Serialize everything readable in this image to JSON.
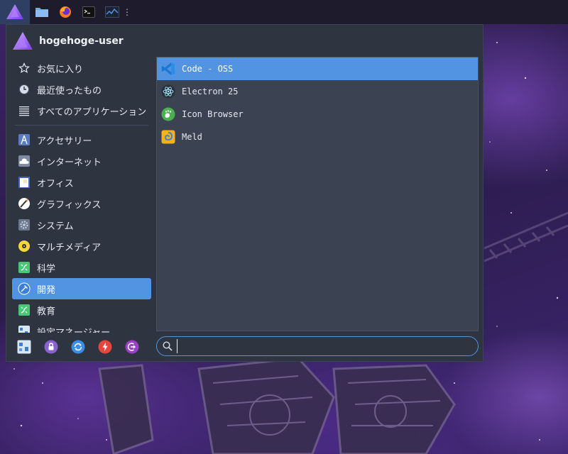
{
  "panel": {
    "apps": [
      {
        "name": "file-manager-icon"
      },
      {
        "name": "firefox-icon"
      },
      {
        "name": "terminal-icon"
      },
      {
        "name": "system-monitor-icon"
      }
    ],
    "separator_glyph": "⋮"
  },
  "menu": {
    "user_name": "hogehoge-user",
    "categories_top": [
      {
        "label": "お気に入り",
        "icon": "star-icon"
      },
      {
        "label": "最近使ったもの",
        "icon": "clock-icon"
      },
      {
        "label": "すべてのアプリケーション",
        "icon": "list-icon"
      }
    ],
    "categories": [
      {
        "label": "アクセサリー",
        "icon": "accessories-icon"
      },
      {
        "label": "インターネット",
        "icon": "cloud-icon"
      },
      {
        "label": "オフィス",
        "icon": "office-icon"
      },
      {
        "label": "グラフィックス",
        "icon": "graphics-icon"
      },
      {
        "label": "システム",
        "icon": "gear-icon"
      },
      {
        "label": "マルチメディア",
        "icon": "multimedia-icon"
      },
      {
        "label": "科学",
        "icon": "science-icon"
      },
      {
        "label": "開発",
        "icon": "development-icon",
        "active": true
      },
      {
        "label": "教育",
        "icon": "education-icon"
      },
      {
        "label": "設定マネージャー",
        "icon": "settings-manager-icon"
      }
    ],
    "apps": [
      {
        "label": "Code - OSS",
        "icon": "vscode-icon",
        "selected": true
      },
      {
        "label": "Electron 25",
        "icon": "electron-icon"
      },
      {
        "label": "Icon Browser",
        "icon": "gnome-icon-browser-icon"
      },
      {
        "label": "Meld",
        "icon": "meld-icon"
      }
    ],
    "search": {
      "value": "",
      "placeholder": ""
    },
    "actions": [
      {
        "name": "settings-manager-action-icon"
      },
      {
        "name": "lock-screen-icon"
      },
      {
        "name": "switch-user-icon"
      },
      {
        "name": "power-icon"
      },
      {
        "name": "logout-icon"
      }
    ]
  },
  "colors": {
    "accent": "#5294e2",
    "menu_bg": "#2e3440",
    "list_bg": "#3b4252",
    "panel_bg": "#1e1b2c"
  }
}
